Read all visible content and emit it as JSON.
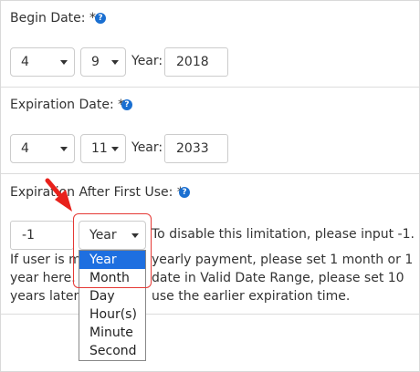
{
  "begin": {
    "label": "Begin Date: *",
    "month": "4",
    "day": "9",
    "year_label": "Year:",
    "year": "2018"
  },
  "expiration": {
    "label": "Expiration Date: *",
    "month": "4",
    "day": "11",
    "year_label": "Year:",
    "year": "2033"
  },
  "after_first_use": {
    "label": "Expiration After First Use: *",
    "value": "-1",
    "unit": "Year",
    "hint_inline": "To disable this limitation, please input -1.",
    "hint_lines": [
      "If user is m",
      "yearly payment, please set 1 month or 1",
      "year here. E",
      "date in Valid Date Range, please set 10",
      "years later.",
      "use the earlier expiration time."
    ],
    "options": [
      "Year",
      "Month",
      "Day",
      "Hour(s)",
      "Minute",
      "Second"
    ],
    "selected_option": "Year"
  },
  "colors": {
    "help_icon": "#1a6fd1",
    "highlight": "#e53935",
    "selected_option_bg": "#1e6fe0"
  }
}
